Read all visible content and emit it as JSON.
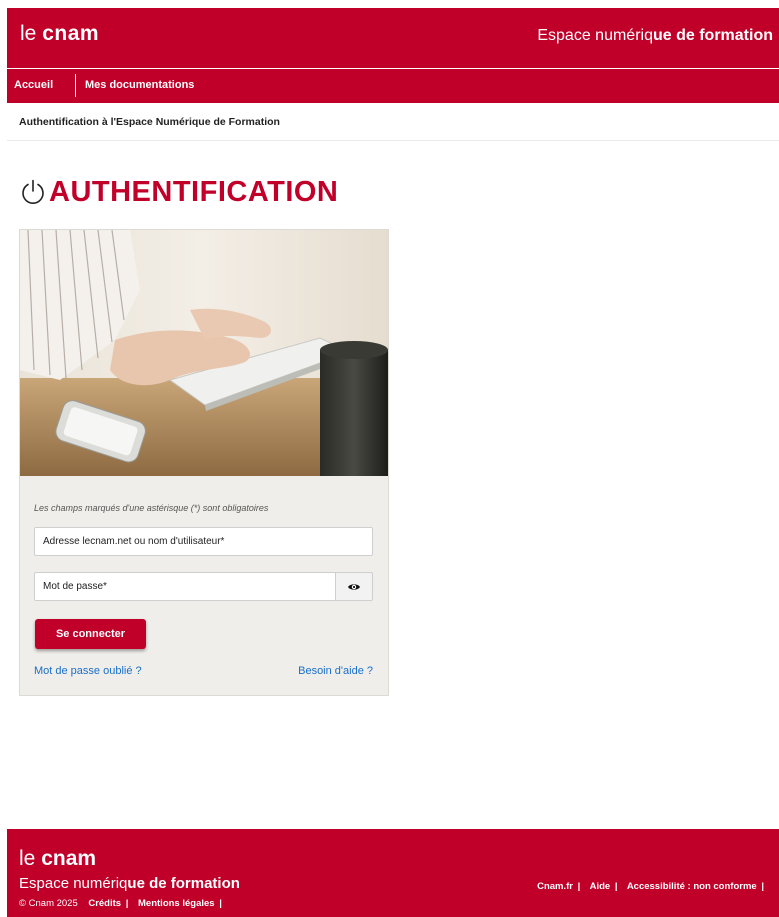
{
  "header": {
    "brand_prefix": "le ",
    "brand_name": "cnam",
    "tagline_light": "Espace numériq",
    "tagline_bold": "ue de formation"
  },
  "nav": {
    "items": [
      {
        "label": "Accueil"
      },
      {
        "label": "Mes documentations"
      }
    ]
  },
  "breadcrumb": "Authentification à l'Espace Numérique de Formation",
  "page_title": "AUTHENTIFICATION",
  "form": {
    "required_note": "Les champs marqués d'une astérisque (*) sont obligatoires",
    "username_placeholder": "Adresse lecnam.net ou nom d'utilisateur*",
    "username_value": "",
    "password_placeholder": "Mot de passe*",
    "password_value": "",
    "submit_label": "Se connecter",
    "forgot_link": "Mot de passe oublié ?",
    "help_link": "Besoin d'aide ?"
  },
  "footer": {
    "brand_prefix": "le ",
    "brand_name": "cnam",
    "tagline_light": "Espace numériq",
    "tagline_bold": "ue de formation",
    "copyright": "© Cnam 2025",
    "links_left": [
      {
        "label": "Crédits"
      },
      {
        "label": "Mentions légales"
      }
    ],
    "links_right": [
      {
        "label": "Cnam.fr"
      },
      {
        "label": "Aide"
      },
      {
        "label": "Accessibilité : non conforme"
      }
    ],
    "separator": "|"
  },
  "icons": {
    "title_icon": "power-icon",
    "password_toggle": "eye-icon"
  },
  "colors": {
    "brand_red": "#c1002a",
    "link_blue": "#1a6fc9",
    "card_bg": "#efeeea"
  }
}
